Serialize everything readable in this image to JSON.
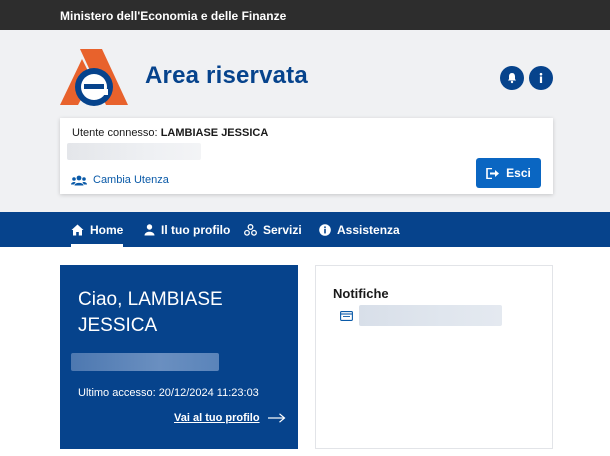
{
  "topbar": {
    "ministry": "Ministero dell'Economia e delle Finanze"
  },
  "header": {
    "title": "Area riservata"
  },
  "user_card": {
    "connected_label": "Utente connesso:",
    "user_name": "LAMBIASE JESSICA",
    "change_user_label": "Cambia Utenza",
    "logout_label": "Esci"
  },
  "nav": {
    "items": [
      {
        "label": "Home",
        "icon": "home-icon",
        "active": true
      },
      {
        "label": "Il tuo profilo",
        "icon": "user-icon",
        "active": false
      },
      {
        "label": "Servizi",
        "icon": "services-icon",
        "active": false
      },
      {
        "label": "Assistenza",
        "icon": "info-icon",
        "active": false
      }
    ]
  },
  "welcome": {
    "greeting": "Ciao, LAMBIASE JESSICA",
    "last_access": "Ultimo accesso: 20/12/2024 11:23:03",
    "profile_link": "Vai al tuo profilo"
  },
  "notifications": {
    "title": "Notifiche"
  },
  "colors": {
    "primary": "#06438c",
    "button": "#0a66c2",
    "topbar": "#2d2d2d",
    "header_bg": "#f0f1f3",
    "logo_orange": "#e8622c"
  }
}
